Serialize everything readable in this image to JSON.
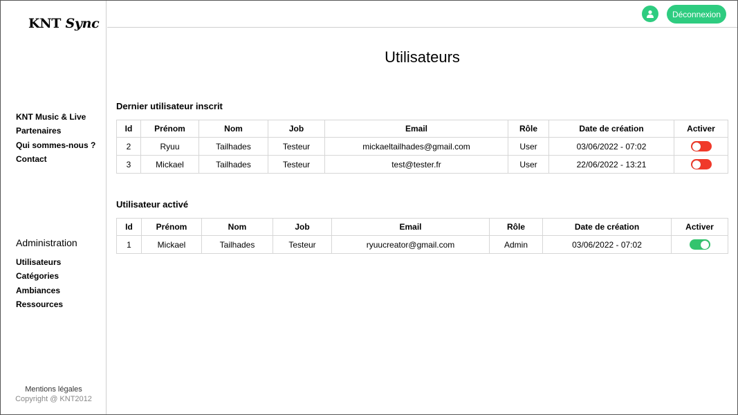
{
  "sidebar": {
    "logo_main": "KNT",
    "logo_script": "Sync",
    "nav": [
      "KNT Music & Live",
      "Partenaires",
      "Qui sommes-nous ?",
      "Contact"
    ],
    "admin_title": "Administration",
    "admin_nav": [
      "Utilisateurs",
      "Catégories",
      "Ambiances",
      "Ressources"
    ],
    "footer_legal": "Mentions légales",
    "footer_copyright": "Copyright @ KNT2012"
  },
  "header": {
    "user_icon": "user-icon",
    "logout_label": "Déconnexion"
  },
  "page": {
    "title": "Utilisateurs"
  },
  "colors": {
    "accent": "#2ecc80",
    "toggle_off": "#f03a2a",
    "toggle_on": "#34c46e"
  },
  "latest_users": {
    "title": "Dernier utilisateur inscrit",
    "columns": [
      "Id",
      "Prénom",
      "Nom",
      "Job",
      "Email",
      "Rôle",
      "Date de création",
      "Activer"
    ],
    "rows": [
      {
        "id": "2",
        "prenom": "Ryuu",
        "nom": "Tailhades",
        "job": "Testeur",
        "email": "mickaeltailhades@gmail.com",
        "role": "User",
        "date": "03/06/2022 - 07:02",
        "active": false
      },
      {
        "id": "3",
        "prenom": "Mickael",
        "nom": "Tailhades",
        "job": "Testeur",
        "email": "test@tester.fr",
        "role": "User",
        "date": "22/06/2022 - 13:21",
        "active": false
      }
    ]
  },
  "active_users": {
    "title": "Utilisateur activé",
    "columns": [
      "Id",
      "Prénom",
      "Nom",
      "Job",
      "Email",
      "Rôle",
      "Date de création",
      "Activer"
    ],
    "rows": [
      {
        "id": "1",
        "prenom": "Mickael",
        "nom": "Tailhades",
        "job": "Testeur",
        "email": "ryuucreator@gmail.com",
        "role": "Admin",
        "date": "03/06/2022 - 07:02",
        "active": true
      }
    ]
  }
}
